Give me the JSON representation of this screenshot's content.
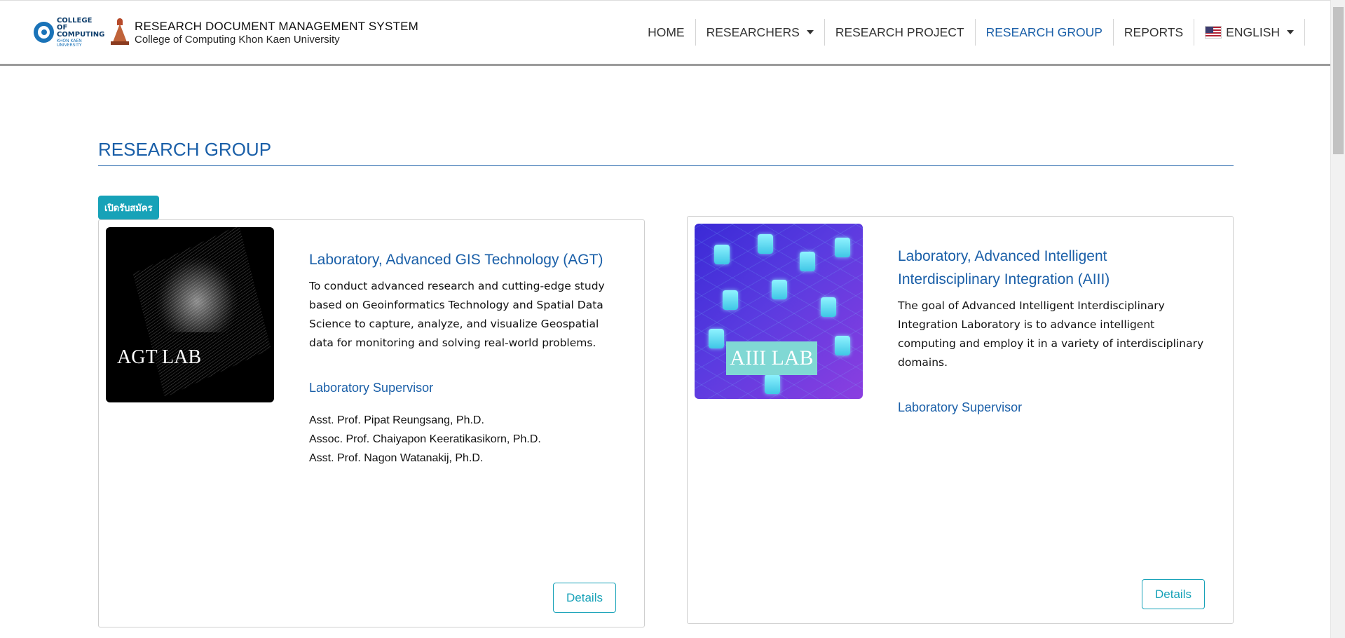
{
  "header": {
    "logo_line1": "COLLEGE OF",
    "logo_line2": "COMPUTING",
    "logo_line3": "KHON KAEN UNIVERSITY",
    "title": "RESEARCH DOCUMENT MANAGEMENT SYSTEM",
    "subtitle": "College of Computing Khon Kaen University"
  },
  "nav": {
    "home": "HOME",
    "researchers": "RESEARCHERS",
    "research_project": "RESEARCH PROJECT",
    "research_group": "RESEARCH GROUP",
    "reports": "REPORTS",
    "language": "ENGLISH"
  },
  "page": {
    "title": "RESEARCH GROUP",
    "badge": "เปิดรับสมัคร"
  },
  "groups": [
    {
      "image_label": "AGT LAB",
      "title": "Laboratory, Advanced GIS Technology (AGT)",
      "description": "To conduct advanced research and cutting-edge study based on Geoinformatics Technology and Spatial Data Science to capture, analyze, and visualize Geospatial data for monitoring and solving real-world problems.",
      "supervisor_label": "Laboratory Supervisor",
      "supervisors": [
        "Asst. Prof. Pipat Reungsang, Ph.D.",
        "Assoc. Prof. Chaiyapon Keeratikasikorn, Ph.D.",
        "Asst. Prof. Nagon Watanakij, Ph.D."
      ],
      "details_label": "Details"
    },
    {
      "image_label": "AIII LAB",
      "title": "Laboratory, Advanced Intelligent Interdisciplinary Integration (AIII)",
      "description": "The goal of Advanced Intelligent Interdisciplinary Integration Laboratory is to advance intelligent computing and employ it in a variety of interdisciplinary domains.",
      "supervisor_label": "Laboratory Supervisor",
      "supervisors": [],
      "details_label": "Details"
    }
  ],
  "colors": {
    "primary": "#1a5fa8",
    "accent": "#17a2b8"
  },
  "icons": {
    "researchers_dropdown": "chevron-down-icon",
    "language_dropdown": "chevron-down-icon",
    "language_flag": "us-flag-icon"
  }
}
